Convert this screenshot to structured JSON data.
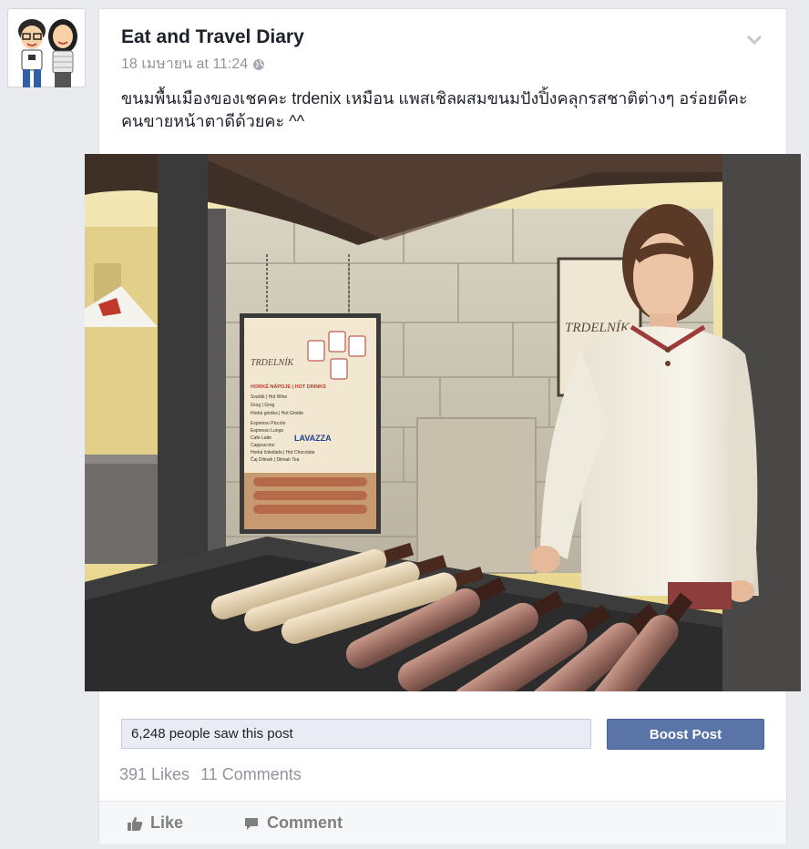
{
  "post": {
    "page_name": "Eat and Travel Diary",
    "timestamp": "18 เมษายน at 11:24",
    "text": "ขนมพื้นเมืองของเชคคะ trdenix เหมือน แพสเชิลผสมขนมปังปิ้งคลุกรสชาติต่างๆ อร่อยดีคะ คนขายหน้าตาดีด้วยคะ ^^",
    "reach_text": "6,248 people saw this post",
    "boost_label": "Boost Post",
    "likes": "391 Likes",
    "comments": "11 Comments"
  },
  "photo": {
    "menu_board": {
      "brand": "TRDELNÍK",
      "header": "HORKÉ NÁPOJE | HOT DRINKS",
      "items": [
        "Svařák | Hot Wine",
        "Grog | Grog",
        "Horká griotka | Hot Griotte",
        "Espresso Piccolo",
        "Espresso Lungo",
        "Cafe Latte",
        "Cappuccino",
        "Horká čokoláda | Hot Chocolate",
        "Čaj Dilmah | Dilmah Tea"
      ],
      "sponsor": "LAVAZZA"
    },
    "back_sign": "TRDELNÍK"
  },
  "actions": {
    "like_label": "Like",
    "comment_label": "Comment"
  },
  "colors": {
    "brand_blue": "#5b74a8",
    "text": "#1d2129",
    "muted": "#90949c"
  },
  "icons": [
    "globe-icon",
    "chevron-down-icon",
    "thumbs-up-icon",
    "comment-bubble-icon"
  ]
}
